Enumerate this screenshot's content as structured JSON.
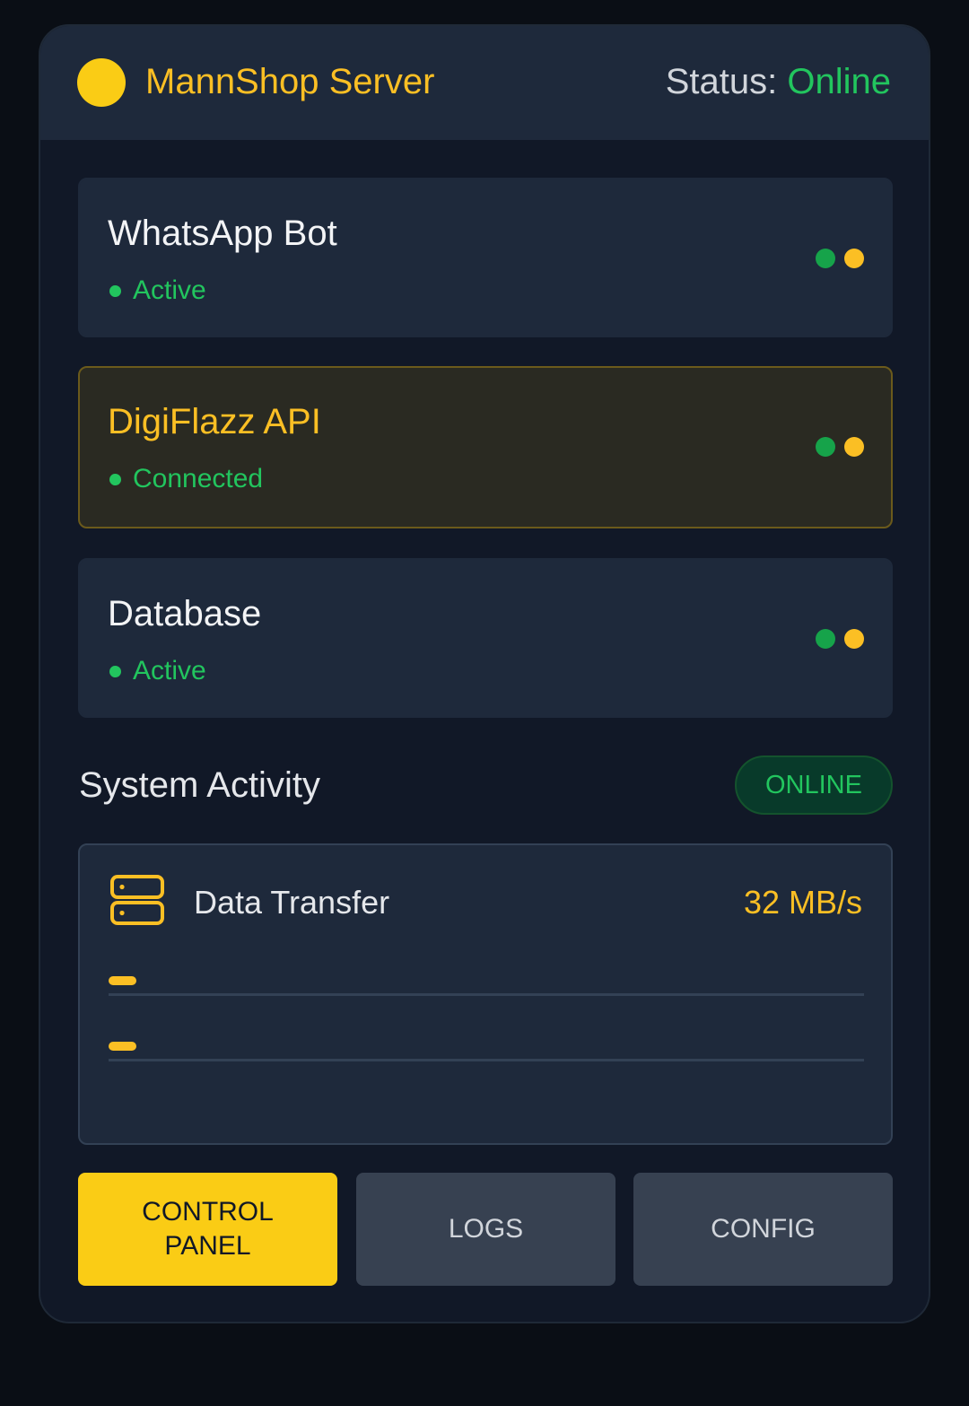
{
  "header": {
    "title": "MannShop Server",
    "status_label": "Status:",
    "status_value": "Online"
  },
  "services": [
    {
      "name": "WhatsApp Bot",
      "state": "Active",
      "highlighted": false
    },
    {
      "name": "DigiFlazz API",
      "state": "Connected",
      "highlighted": true
    },
    {
      "name": "Database",
      "state": "Active",
      "highlighted": false
    }
  ],
  "activity": {
    "title": "System Activity",
    "badge": "ONLINE",
    "transfer_label": "Data Transfer",
    "transfer_value": "32 MB/s",
    "bars": [
      {
        "level": 0.037
      },
      {
        "level": 0.037
      }
    ]
  },
  "buttons": {
    "control_panel": "CONTROL\nPANEL",
    "logs": "LOGS",
    "config": "CONFIG"
  },
  "colors": {
    "accent": "#facc15",
    "online": "#22c55e",
    "background": "#111827"
  }
}
